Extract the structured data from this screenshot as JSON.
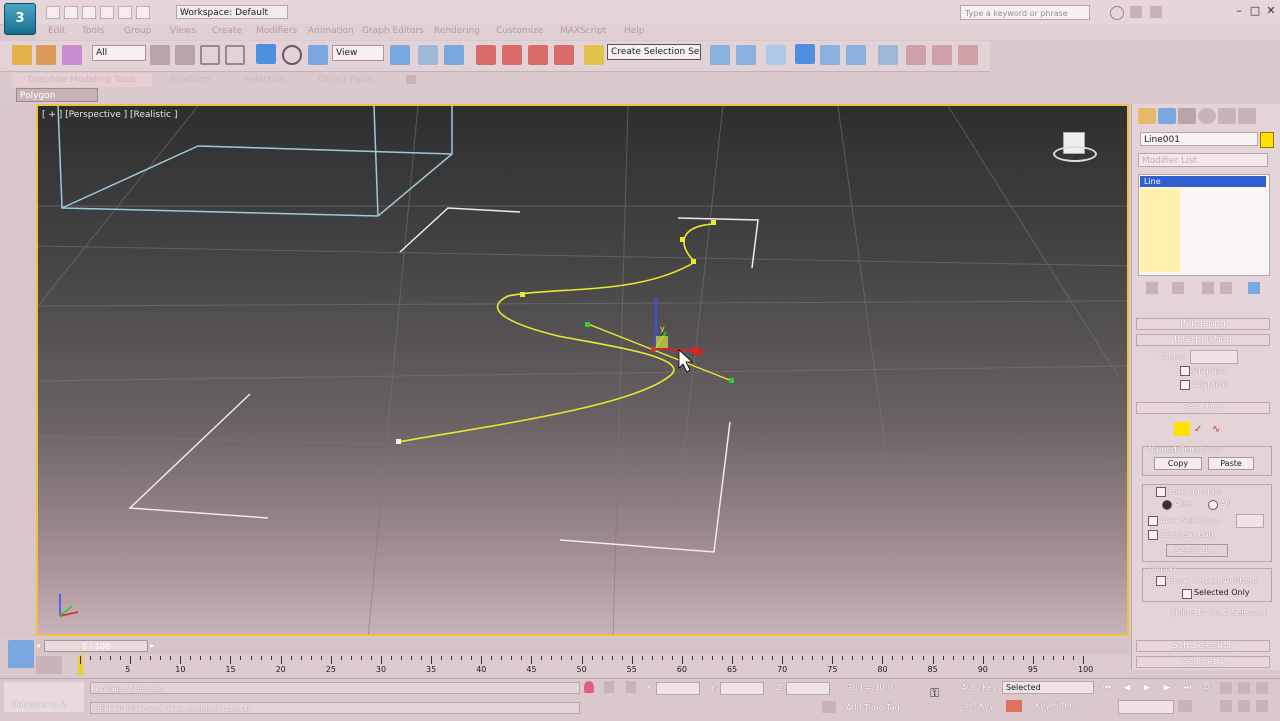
{
  "titlebar": {
    "app_logo": "3",
    "workspace": "Workspace: Default",
    "search_placeholder": "Type a keyword or phrase",
    "controls": [
      "–",
      "□",
      "✕"
    ]
  },
  "menubar": {
    "items": [
      "Edit",
      "Tools",
      "Group",
      "Views",
      "Create",
      "Modifiers",
      "Animation",
      "Graph Editors",
      "Rendering",
      "Customize",
      "MAXScript",
      "Help"
    ]
  },
  "toolbar": {
    "filter_value": "All",
    "ref_coord_value": "View",
    "named_selection_value": "Create Selection Se"
  },
  "ribbon": {
    "tabs": [
      "Graphite Modeling Tools",
      "Freeform",
      "Selection",
      "Object Paint"
    ],
    "active_panel": "Polygon Modeling"
  },
  "viewport": {
    "label": "[ + ] [Perspective ] [Realistic ]",
    "gizmo_label": "y",
    "accent_color": "#f0c040",
    "spline_color": "#e8e830"
  },
  "command_panel": {
    "object_name": "Line001",
    "object_color": "#ffe000",
    "modifier_list": "Modifier List",
    "stack_item": "Line",
    "rollouts": {
      "rendering": "Rendering",
      "interpolation": "Interpolation",
      "steps_label": "Steps:",
      "optimize": "Optimize",
      "adaptive": "Adaptive",
      "selection": "Selection",
      "named_selections": "Named Selections:",
      "copy": "Copy",
      "paste": "Paste",
      "lock_handles": "Lock Handles",
      "alike": "Alike",
      "all": "All",
      "area_selection": "Area Selection:",
      "segment_end": "Segment End",
      "select_by": "Select By...",
      "display": "Display",
      "show_vertex_numbers": "Show Vertex Numbers",
      "selected_only": "Selected Only",
      "selection_status": "Spline 1/Vert 2 Selected",
      "soft_selection": "Soft Selection",
      "geometry": "Geometry"
    }
  },
  "timeline": {
    "frame_display": "0 / 100",
    "ticks": [
      "5",
      "10",
      "15",
      "20",
      "25",
      "30",
      "35",
      "40",
      "45",
      "50",
      "55",
      "60",
      "65",
      "70",
      "75",
      "80",
      "85",
      "90",
      "95",
      "100"
    ]
  },
  "statusbar": {
    "selection_text": "1 Shape Selected",
    "prompt_text": "Click or click-and-drag to select objects",
    "welcome_text": "Welcome to M",
    "x_label": "X:",
    "y_label": "Y:",
    "z_label": "Z:",
    "grid_text": "Grid = 10.0",
    "add_time_tag": "Add Time Tag",
    "auto_key": "Auto Key",
    "set_key": "Set Key",
    "key_filters": "Key Filters...",
    "key_mode_value": "Selected"
  }
}
